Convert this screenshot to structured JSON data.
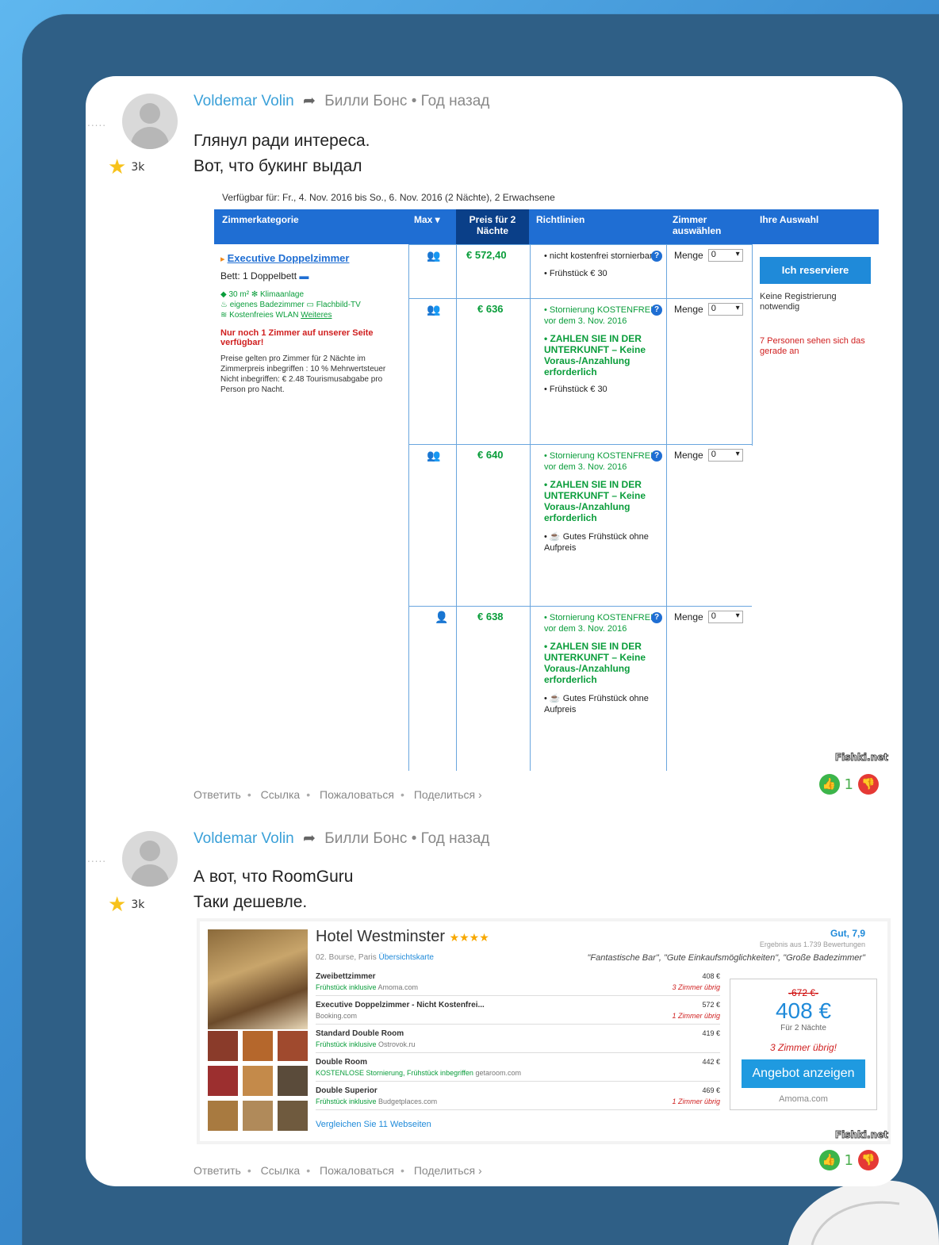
{
  "comment1": {
    "author": "Voldemar Volin",
    "reply_to": "Билли Бонс",
    "time": "Год назад",
    "rating": "3k",
    "lines": [
      "Глянул ради интереса.",
      "Вот, что букинг выдал"
    ],
    "votes_up": "1",
    "actions": [
      "Ответить",
      "Ссылка",
      "Пожаловаться",
      "Поделиться ›"
    ]
  },
  "booking": {
    "availability": "Verfügbar für: Fr., 4. Nov. 2016 bis So., 6. Nov. 2016 (2 Nächte), 2 Erwachsene",
    "headers": [
      "Zimmerkategorie",
      "Max ▾",
      "Preis für 2 Nächte",
      "Richtlinien",
      "Zimmer auswählen",
      "Ihre Auswahl"
    ],
    "room_name": "Executive Doppelzimmer",
    "bed": "Bett: 1 Doppelbett",
    "features": [
      "30 m²",
      "Klimaanlage",
      "eigenes Badezimmer",
      "Flachbild-TV",
      "Kostenfreies WLAN",
      "Weiteres"
    ],
    "scarcity": "Nur noch 1 Zimmer auf unserer Seite verfügbar!",
    "price_note": "Preise gelten pro Zimmer für 2 Nächte im Zimmerpreis inbegriffen : 10 % Mehrwertsteuer",
    "excluded": "Nicht inbegriffen: € 2.48 Tourismusabgabe pro Person pro Nacht.",
    "rows": [
      {
        "price": "€ 572,40",
        "policy1": "nicht kostenfrei stornierbar",
        "policy2": "Frühstück € 30"
      },
      {
        "price": "€ 636",
        "policy1": "Stornierung KOSTENFREI vor dem 3. Nov. 2016",
        "policy2": "ZAHLEN SIE IN DER UNTERKUNFT – Keine Voraus-/Anzahlung erforderlich",
        "policy3": "Frühstück € 30"
      },
      {
        "price": "€ 640",
        "policy1": "Stornierung KOSTENFREI vor dem 3. Nov. 2016",
        "policy2": "ZAHLEN SIE IN DER UNTERKUNFT – Keine Voraus-/Anzahlung erforderlich",
        "policy3": "Gutes Frühstück ohne Aufpreis"
      },
      {
        "price": "€ 638",
        "policy1": "Stornierung KOSTENFREI vor dem 3. Nov. 2016",
        "policy2": "ZAHLEN SIE IN DER UNTERKUNFT – Keine Voraus-/Anzahlung erforderlich",
        "policy3": "Gutes Frühstück ohne Aufpreis"
      }
    ],
    "menge_label": "Menge",
    "menge_value": "0",
    "reserve_button": "Ich reserviere",
    "no_registration": "Keine Registrierung notwendig",
    "viewers": "7 Personen sehen sich das gerade an"
  },
  "watermark": "Fishki.net",
  "comment2": {
    "author": "Voldemar Volin",
    "reply_to": "Билли Бонс",
    "time": "Год назад",
    "rating": "3k",
    "lines": [
      "А вот, что RoomGuru",
      "Таки дешевле."
    ],
    "votes_up": "1",
    "actions": [
      "Ответить",
      "Ссылка",
      "Пожаловаться",
      "Поделиться ›"
    ]
  },
  "roomguru": {
    "hotel": "Hotel Westminster",
    "stars": "★★★★",
    "address": "02. Bourse, Paris",
    "map_link": "Übersichtskarte",
    "score": "Gut, 7,9",
    "reviews": "Ergebnis aus 1.739 Bewertungen",
    "quotes": "\"Fantastische Bar\", \"Gute Einkaufsmöglichkeiten\", \"Große Badezimmer\"",
    "offers": [
      {
        "name": "Zweibettzimmer",
        "sub": "Frühstück inklusive",
        "site": "Amoma.com",
        "price": "408 €",
        "left": "3 Zimmer übrig"
      },
      {
        "name": "Executive Doppelzimmer - Nicht Kostenfrei...",
        "sub": "",
        "site": "Booking.com",
        "price": "572 €",
        "left": "1 Zimmer übrig"
      },
      {
        "name": "Standard Double Room",
        "sub": "Frühstück inklusive",
        "site": "Ostrovok.ru",
        "price": "419 €",
        "left": ""
      },
      {
        "name": "Double Room",
        "sub": "KOSTENLOSE Stornierung, Frühstück inbegriffen",
        "site": "getaroom.com",
        "price": "442 €",
        "left": ""
      },
      {
        "name": "Double Superior",
        "sub": "Frühstück inklusive",
        "site": "Budgetplaces.com",
        "price": "469 €",
        "left": "1 Zimmer übrig"
      }
    ],
    "compare": "Vergleichen Sie 11 Webseiten",
    "old_price": "-672 €-",
    "new_price": "408 €",
    "per": "Für 2 Nächte",
    "rooms_left": "3 Zimmer übrig!",
    "cta": "Angebot anzeigen",
    "cta_site": "Amoma.com"
  }
}
